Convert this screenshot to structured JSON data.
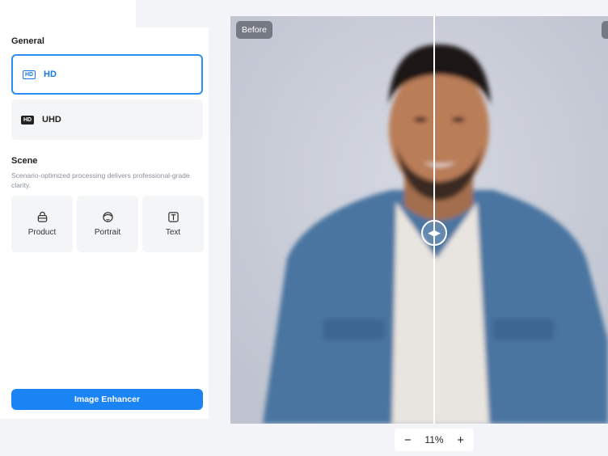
{
  "sidebar": {
    "general_title": "General",
    "quality_options": [
      {
        "icon": "hd-icon",
        "badge": "HD",
        "label": "HD",
        "selected": true
      },
      {
        "icon": "uhd-icon",
        "badge": "HD",
        "label": "UHD",
        "selected": false
      }
    ],
    "scene_title": "Scene",
    "scene_description": "Scenario-optimized processing delivers professional-grade clarity.",
    "scenes": [
      {
        "icon": "bag-icon",
        "label": "Product"
      },
      {
        "icon": "face-icon",
        "label": "Portrait"
      },
      {
        "icon": "text-t-icon",
        "label": "Text"
      }
    ],
    "action_button": "Image Enhancer"
  },
  "preview": {
    "before_label": "Before",
    "compare_position": 0.54
  },
  "zoom": {
    "minus": "−",
    "level": "11%",
    "plus": "+"
  },
  "colors": {
    "accent": "#1a84f5",
    "selected_border": "#2a8df0"
  }
}
